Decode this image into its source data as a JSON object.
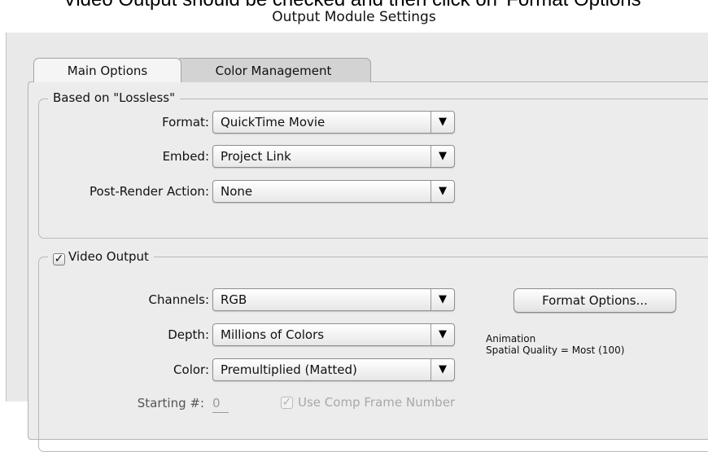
{
  "caption": "Video Output should be checked and then click on 'Format Options'",
  "window": {
    "title": "Output Module Settings"
  },
  "tabs": [
    {
      "label": "Main Options",
      "active": true
    },
    {
      "label": "Color Management",
      "active": false
    }
  ],
  "based_on": {
    "label": "Based on \"Lossless\"",
    "format": {
      "label": "Format:",
      "value": "QuickTime Movie"
    },
    "embed": {
      "label": "Embed:",
      "value": "Project Link"
    },
    "post_render": {
      "label": "Post-Render Action:",
      "value": "None"
    }
  },
  "video_output": {
    "label": "Video Output",
    "checked": true,
    "check_glyph": "✓",
    "dropdown_arrow": "▼",
    "channels": {
      "label": "Channels:",
      "value": "RGB"
    },
    "depth": {
      "label": "Depth:",
      "value": "Millions of Colors"
    },
    "color": {
      "label": "Color:",
      "value": "Premultiplied (Matted)"
    },
    "format_options_button": "Format Options...",
    "format_info": {
      "codec": "Animation",
      "quality": "Spatial Quality = Most (100)"
    },
    "starting": {
      "label": "Starting #:",
      "value": "0"
    },
    "use_comp_frame": {
      "label": "Use Comp Frame Number",
      "checked": true,
      "disabled": true
    }
  }
}
